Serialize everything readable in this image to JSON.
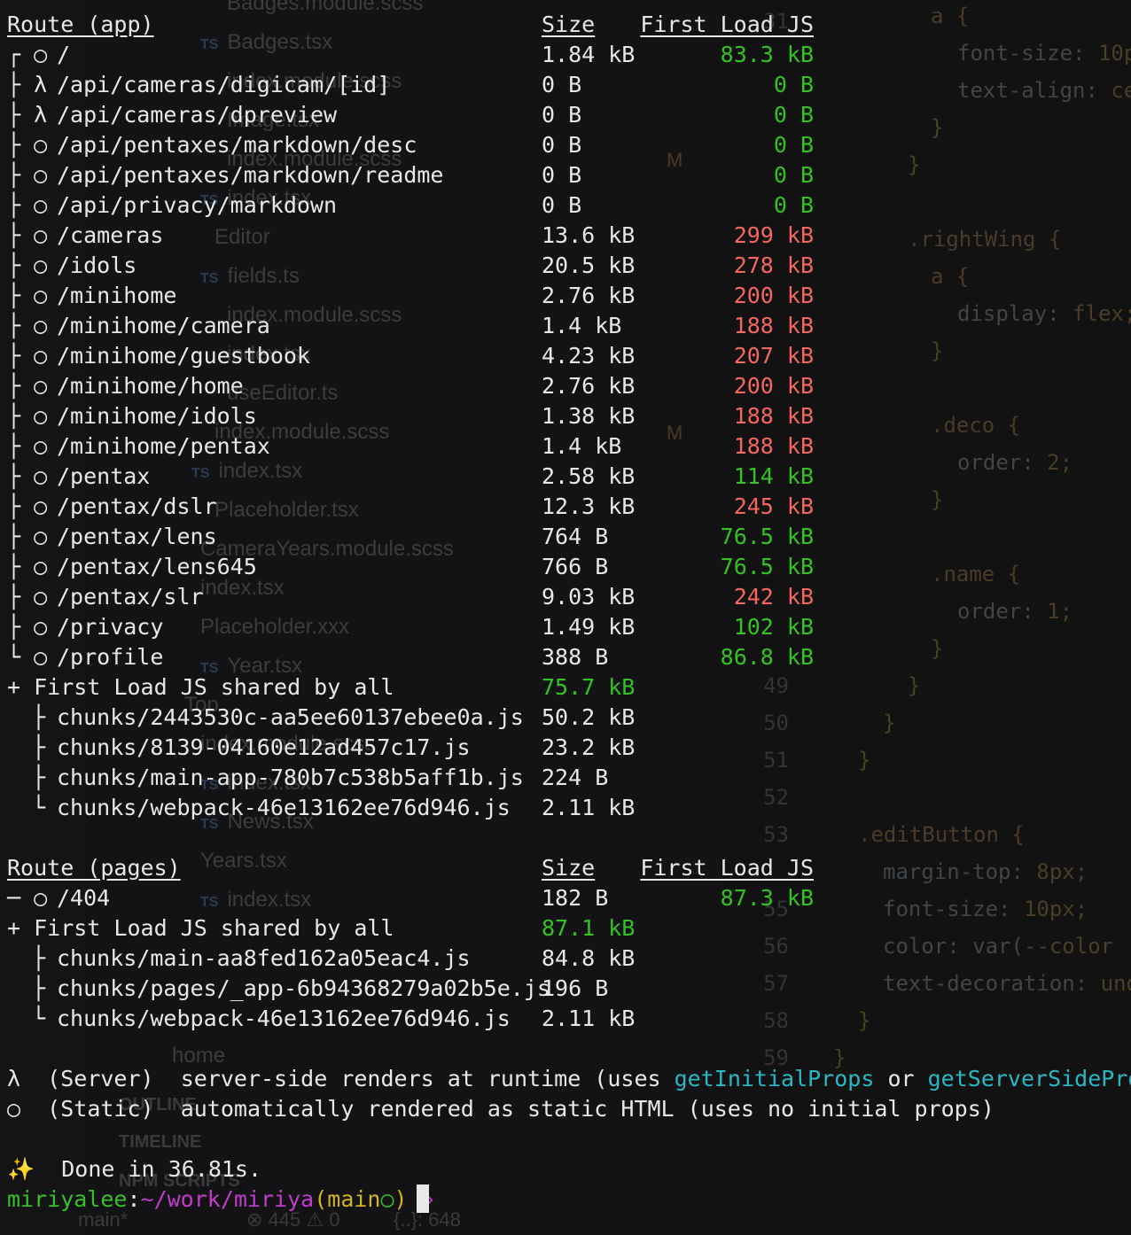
{
  "app_table": {
    "header": {
      "route": "Route (app)",
      "size": "Size",
      "first_load": "First Load JS"
    },
    "rows": [
      {
        "prefix": "┌ ○",
        "route": "/",
        "size": "1.84 kB",
        "load": "83.3 kB",
        "load_status": "green"
      },
      {
        "prefix": "├ λ",
        "route": "/api/cameras/digicam/[id]",
        "size": "0 B",
        "load": "0 B",
        "load_status": "green"
      },
      {
        "prefix": "├ λ",
        "route": "/api/cameras/dpreview",
        "size": "0 B",
        "load": "0 B",
        "load_status": "green"
      },
      {
        "prefix": "├ ○",
        "route": "/api/pentaxes/markdown/desc",
        "size": "0 B",
        "load": "0 B",
        "load_status": "green"
      },
      {
        "prefix": "├ ○",
        "route": "/api/pentaxes/markdown/readme",
        "size": "0 B",
        "load": "0 B",
        "load_status": "green"
      },
      {
        "prefix": "├ ○",
        "route": "/api/privacy/markdown",
        "size": "0 B",
        "load": "0 B",
        "load_status": "green"
      },
      {
        "prefix": "├ ○",
        "route": "/cameras",
        "size": "13.6 kB",
        "load": "299 kB",
        "load_status": "red"
      },
      {
        "prefix": "├ ○",
        "route": "/idols",
        "size": "20.5 kB",
        "load": "278 kB",
        "load_status": "red"
      },
      {
        "prefix": "├ ○",
        "route": "/minihome",
        "size": "2.76 kB",
        "load": "200 kB",
        "load_status": "red"
      },
      {
        "prefix": "├ ○",
        "route": "/minihome/camera",
        "size": "1.4 kB",
        "load": "188 kB",
        "load_status": "red"
      },
      {
        "prefix": "├ ○",
        "route": "/minihome/guestbook",
        "size": "4.23 kB",
        "load": "207 kB",
        "load_status": "red"
      },
      {
        "prefix": "├ ○",
        "route": "/minihome/home",
        "size": "2.76 kB",
        "load": "200 kB",
        "load_status": "red"
      },
      {
        "prefix": "├ ○",
        "route": "/minihome/idols",
        "size": "1.38 kB",
        "load": "188 kB",
        "load_status": "red"
      },
      {
        "prefix": "├ ○",
        "route": "/minihome/pentax",
        "size": "1.4 kB",
        "load": "188 kB",
        "load_status": "red"
      },
      {
        "prefix": "├ ○",
        "route": "/pentax",
        "size": "2.58 kB",
        "load": "114 kB",
        "load_status": "green"
      },
      {
        "prefix": "├ ○",
        "route": "/pentax/dslr",
        "size": "12.3 kB",
        "load": "245 kB",
        "load_status": "red"
      },
      {
        "prefix": "├ ○",
        "route": "/pentax/lens",
        "size": "764 B",
        "load": "76.5 kB",
        "load_status": "green"
      },
      {
        "prefix": "├ ○",
        "route": "/pentax/lens645",
        "size": "766 B",
        "load": "76.5 kB",
        "load_status": "green"
      },
      {
        "prefix": "├ ○",
        "route": "/pentax/slr",
        "size": "9.03 kB",
        "load": "242 kB",
        "load_status": "red"
      },
      {
        "prefix": "├ ○",
        "route": "/privacy",
        "size": "1.49 kB",
        "load": "102 kB",
        "load_status": "green"
      },
      {
        "prefix": "└ ○",
        "route": "/profile",
        "size": "388 B",
        "load": "86.8 kB",
        "load_status": "green"
      }
    ],
    "shared": {
      "label": "+ First Load JS shared by all",
      "total": "75.7 kB"
    },
    "chunks": [
      {
        "prefix": "├",
        "name": "chunks/2443530c-aa5ee60137ebee0a.js",
        "size": "50.2 kB"
      },
      {
        "prefix": "├",
        "name": "chunks/8139-04160e12ad457c17.js",
        "size": "23.2 kB"
      },
      {
        "prefix": "├",
        "name": "chunks/main-app-780b7c538b5aff1b.js",
        "size": "224 B"
      },
      {
        "prefix": "└",
        "name": "chunks/webpack-46e13162ee76d946.js",
        "size": "2.11 kB"
      }
    ]
  },
  "pages_table": {
    "header": {
      "route": "Route (pages)",
      "size": "Size",
      "first_load": "First Load JS"
    },
    "rows": [
      {
        "prefix": "─ ○",
        "route": "/404",
        "size": "182 B",
        "load": "87.3 kB",
        "load_status": "green"
      }
    ],
    "shared": {
      "label": "+ First Load JS shared by all",
      "total": "87.1 kB"
    },
    "chunks": [
      {
        "prefix": "├",
        "name": "chunks/main-aa8fed162a05eac4.js",
        "size": "84.8 kB"
      },
      {
        "prefix": "├",
        "name": "chunks/pages/_app-6b94368279a02b5e.js",
        "size": "196 B"
      },
      {
        "prefix": "└",
        "name": "chunks/webpack-46e13162ee76d946.js",
        "size": "2.11 kB"
      }
    ]
  },
  "legend": {
    "server": {
      "symbol": "λ",
      "label": "(Server)",
      "text_before": "server-side renders at runtime (uses ",
      "fn1": "getInitialProps",
      "or": " or ",
      "fn2": "getServerSideProps",
      "text_after": ")"
    },
    "static": {
      "symbol": "○",
      "label": "(Static)",
      "text": "automatically rendered as static HTML (uses no initial props)"
    }
  },
  "done": {
    "emoji": "✨",
    "text": "Done in 36.81s."
  },
  "prompt": {
    "user": "miriyalee",
    "sep": ":",
    "path": "~/work/miriya",
    "branch_open": "(",
    "branch": "main",
    "branch_status": "○",
    "branch_close": ")",
    "arrow": "»"
  },
  "ghost_editor": {
    "files": [
      {
        "type": "",
        "name": "Badges.module.scss"
      },
      {
        "type": "TS",
        "name": "Badges.tsx"
      },
      {
        "type": "",
        "name": "index.module.scss"
      },
      {
        "type": "",
        "name": "Image.tsx"
      },
      {
        "type": "",
        "name": "index.module.scss"
      },
      {
        "type": "TS",
        "name": "index.tsx"
      },
      {
        "type": "",
        "name": "Editor"
      },
      {
        "type": "TS",
        "name": "fields.ts"
      },
      {
        "type": "",
        "name": "index.module.scss"
      },
      {
        "type": "",
        "name": "index.tsx"
      },
      {
        "type": "",
        "name": "useEditor.ts"
      },
      {
        "type": "",
        "name": "index.module.scss"
      },
      {
        "type": "TS",
        "name": "index.tsx"
      },
      {
        "type": "",
        "name": "Placeholder.tsx"
      },
      {
        "type": "",
        "name": "CameraYears.module.scss"
      },
      {
        "type": "",
        "name": "index.tsx"
      },
      {
        "type": "",
        "name": "Placeholder.xxx"
      },
      {
        "type": "TS",
        "name": "Year.tsx"
      },
      {
        "type": "",
        "name": "Top"
      },
      {
        "type": "",
        "name": "index.module.scss"
      },
      {
        "type": "TS",
        "name": "index.tsx"
      },
      {
        "type": "TS",
        "name": "News.tsx"
      },
      {
        "type": "",
        "name": "Years.tsx"
      },
      {
        "type": "TS",
        "name": "index.tsx"
      },
      {
        "type": "",
        "name": "home"
      }
    ],
    "modified_mark": "M",
    "sections": [
      "OUTLINE",
      "TIMELINE",
      "NPM SCRIPTS"
    ],
    "line_numbers": [
      "31",
      "49",
      "50",
      "51",
      "52",
      "53",
      "55",
      "56",
      "57",
      "58",
      "59"
    ],
    "code_lines": [
      {
        "sel": "a {",
        "prop": "",
        "val": ""
      },
      {
        "sel": "",
        "prop": "font-size: ",
        "val": "10p"
      },
      {
        "sel": "",
        "prop": "text-align: ",
        "val": "ce"
      },
      {
        "sel": "}",
        "prop": "",
        "val": ""
      },
      {
        "sel": "}",
        "prop": "",
        "val": ""
      },
      {
        "sel": ".rightWing {",
        "prop": "",
        "val": ""
      },
      {
        "sel": "a {",
        "prop": "",
        "val": ""
      },
      {
        "sel": "",
        "prop": "display: ",
        "val": "flex;"
      },
      {
        "sel": "}",
        "prop": "",
        "val": ""
      },
      {
        "sel": ".deco {",
        "prop": "",
        "val": ""
      },
      {
        "sel": "",
        "prop": "order: ",
        "val": "2;"
      },
      {
        "sel": "}",
        "prop": "",
        "val": ""
      },
      {
        "sel": ".name {",
        "prop": "",
        "val": ""
      },
      {
        "sel": "",
        "prop": "order: ",
        "val": "1;"
      },
      {
        "sel": "}",
        "prop": "",
        "val": ""
      },
      {
        "sel": "}",
        "prop": "",
        "val": ""
      },
      {
        "sel": "}",
        "prop": "",
        "val": ""
      },
      {
        "sel": "}",
        "prop": "",
        "val": ""
      },
      {
        "sel": ".editButton {",
        "prop": "",
        "val": ""
      },
      {
        "sel": "",
        "prop": "margin-top: ",
        "val": "8px;"
      },
      {
        "sel": "",
        "prop": "font-size: ",
        "val": "10px;"
      },
      {
        "sel": "",
        "prop": "color: var(",
        "val": "--color"
      },
      {
        "sel": "",
        "prop": "text-decoration: ",
        "val": "und"
      },
      {
        "sel": "}",
        "prop": "",
        "val": ""
      },
      {
        "sel": "}",
        "prop": "",
        "val": ""
      }
    ],
    "status_bar": [
      "main*",
      "⊗ 445 ⚠ 0",
      "{..}: 648"
    ]
  }
}
